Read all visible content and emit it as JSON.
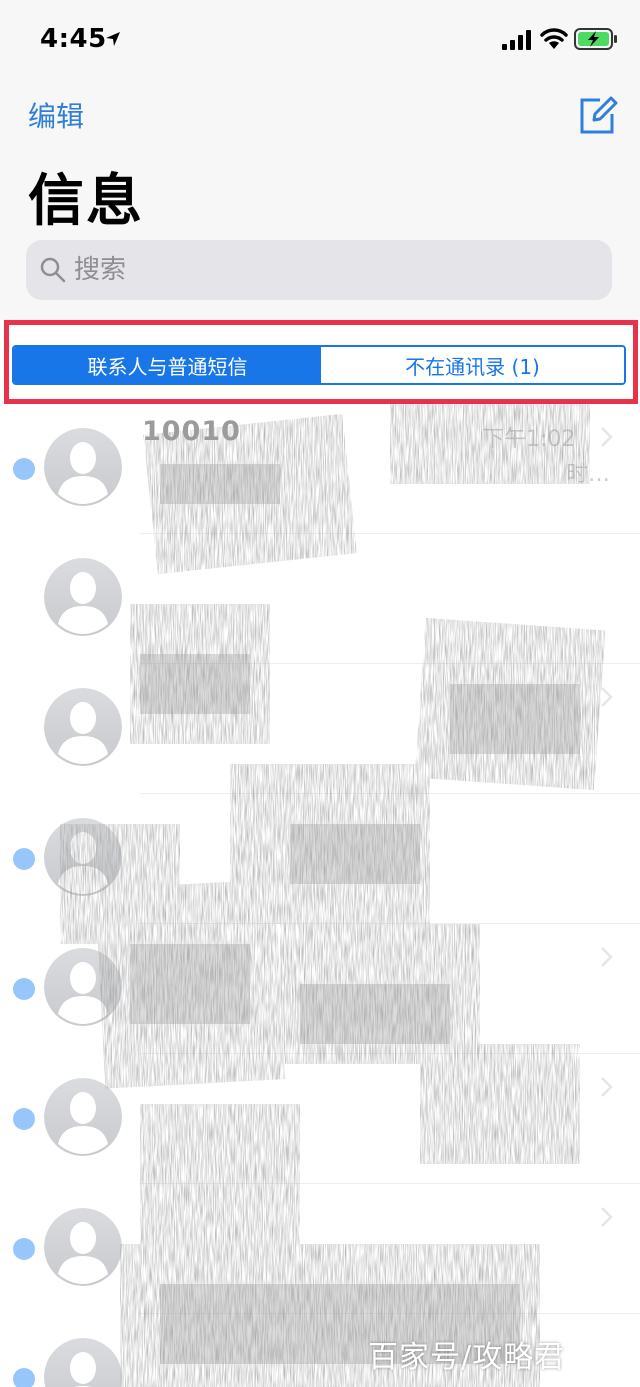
{
  "status_bar": {
    "time": "4:45"
  },
  "header": {
    "edit_label": "编辑",
    "title": "信息",
    "search_placeholder": "搜索"
  },
  "segmented_control": {
    "tabs": [
      {
        "label": "联系人与普通短信",
        "selected": true
      },
      {
        "label": "不在通讯录 (1)",
        "selected": false
      }
    ]
  },
  "conversations": [
    {
      "sender": "10010",
      "time": "下午1:02",
      "preview_tail": "时…",
      "unread": true
    },
    {
      "sender": "",
      "time": "",
      "preview_tail": "",
      "unread": false
    },
    {
      "sender": "",
      "time": "",
      "preview_tail": "",
      "unread": false
    },
    {
      "sender": "",
      "time": "",
      "preview_tail": "",
      "unread": true
    },
    {
      "sender": "",
      "time": "",
      "preview_tail": "",
      "unread": true
    },
    {
      "sender": "",
      "time": "",
      "preview_tail": "",
      "unread": true
    },
    {
      "sender": "",
      "time": "",
      "preview_tail": "",
      "unread": true
    },
    {
      "sender": "",
      "time": "",
      "preview_tail": "",
      "unread": true
    }
  ],
  "watermark": "百家号/攻略君",
  "colors": {
    "accent": "#1876e8",
    "highlight": "#e8324a",
    "unread_dot": "#1a82f7"
  },
  "icons": [
    "location-arrow-icon",
    "signal-icon",
    "wifi-icon",
    "battery-charging-icon",
    "compose-icon",
    "search-icon",
    "chevron-right-icon",
    "contact-avatar-icon"
  ]
}
